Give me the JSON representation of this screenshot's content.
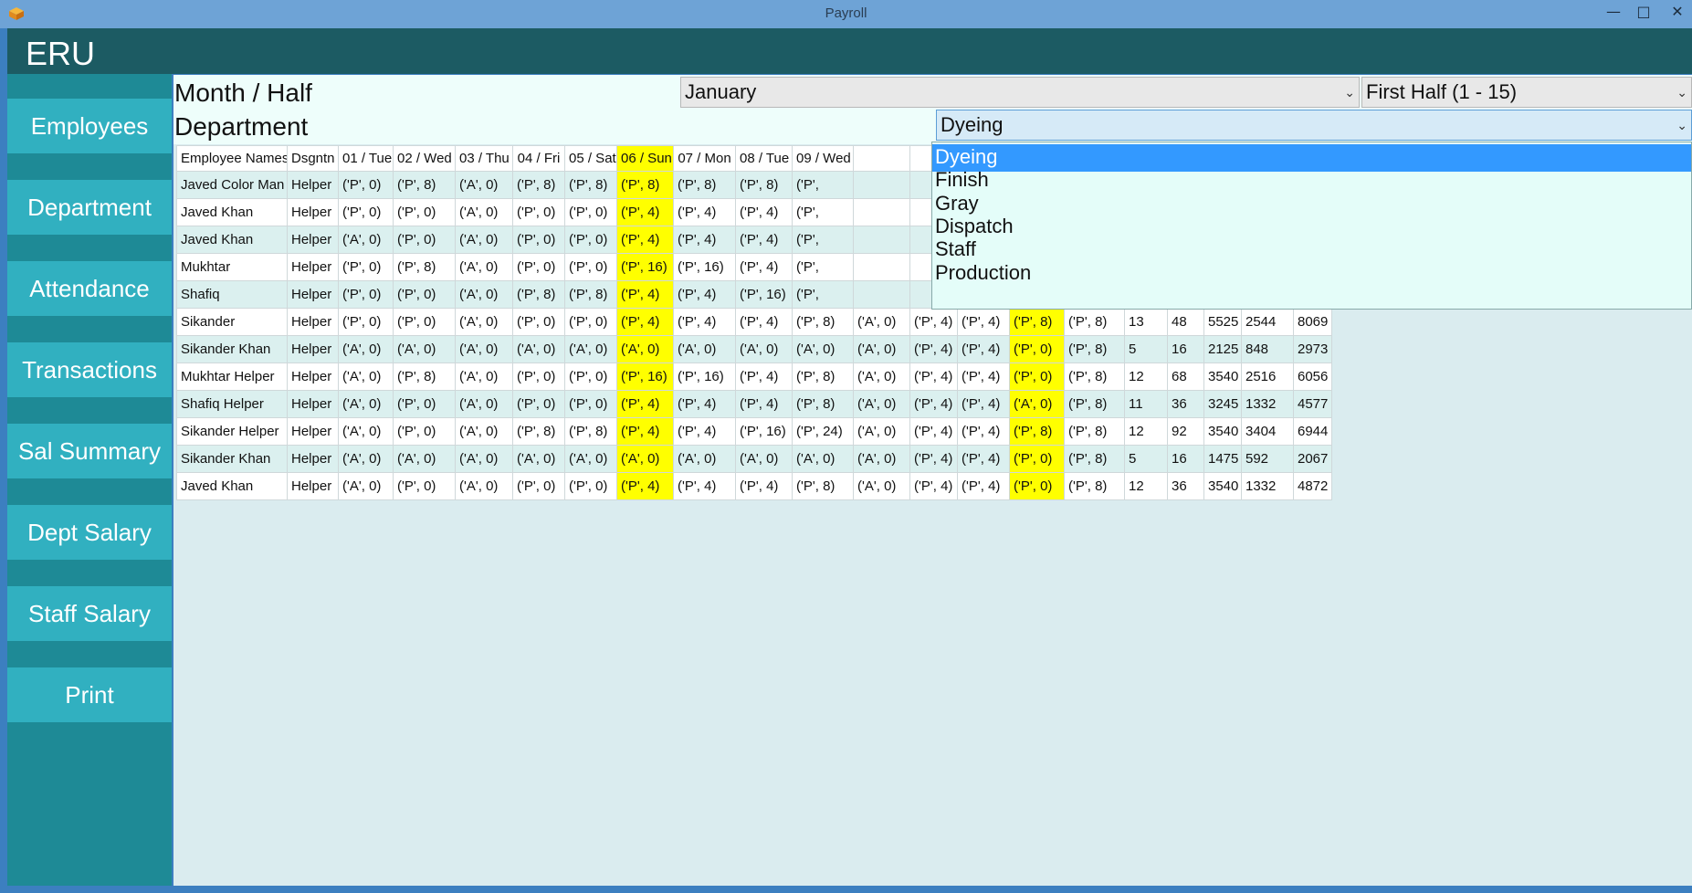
{
  "window": {
    "title": "Payroll",
    "min": "—",
    "max": "□",
    "close": "✕"
  },
  "app": {
    "name": "ERU"
  },
  "sidebar": {
    "items": [
      {
        "label": "Employees"
      },
      {
        "label": "Department"
      },
      {
        "label": "Attendance"
      },
      {
        "label": "Transactions"
      },
      {
        "label": "Sal Summary"
      },
      {
        "label": "Dept Salary"
      },
      {
        "label": "Staff Salary"
      },
      {
        "label": "Print"
      }
    ]
  },
  "filters": {
    "month_label": "Month / Half",
    "department_label": "Department",
    "month_value": "January",
    "half_value": "First Half (1 - 15)",
    "department_value": "Dyeing"
  },
  "dropdown": {
    "options": [
      "Dyeing",
      "Finish",
      "Gray",
      "Dispatch",
      "Staff",
      "Production"
    ],
    "selected": "Dyeing"
  },
  "colors": {
    "highlight": "#ffff00",
    "accent": "#31b0c0",
    "header": "#1c5b63",
    "selection": "#3399ff"
  },
  "table": {
    "headers": [
      "Employee Names",
      "Dsgntn",
      "01 / Tue",
      "02 / Wed",
      "03 / Thu",
      "04 / Fri",
      "05 / Sat",
      "06 / Sun",
      "07 / Mon",
      "08 / Tue",
      "09 / Wed",
      "",
      "",
      "",
      "",
      "",
      "",
      "",
      "",
      "",
      ""
    ],
    "rows": [
      [
        "Javed Color Man",
        "Helper",
        "('P', 0)",
        "('P', 8)",
        "('A', 0)",
        "('P', 8)",
        "('P', 8)",
        "('P', 8)",
        "('P', 8)",
        "('P', 8)",
        "('P', ",
        "",
        "",
        "",
        "",
        "",
        "",
        "",
        "",
        "",
        ""
      ],
      [
        "Javed Khan",
        "Helper",
        "('P', 0)",
        "('P', 0)",
        "('A', 0)",
        "('P', 0)",
        "('P', 0)",
        "('P', 4)",
        "('P', 4)",
        "('P', 4)",
        "('P', ",
        "",
        "",
        "",
        "",
        "",
        "",
        "",
        "",
        "",
        ""
      ],
      [
        "Javed Khan",
        "Helper",
        "('A', 0)",
        "('P', 0)",
        "('A', 0)",
        "('P', 0)",
        "('P', 0)",
        "('P', 4)",
        "('P', 4)",
        "('P', 4)",
        "('P', ",
        "",
        "",
        "",
        "",
        "",
        "",
        "",
        "",
        "",
        ""
      ],
      [
        "Mukhtar",
        "Helper",
        "('P', 0)",
        "('P', 8)",
        "('A', 0)",
        "('P', 0)",
        "('P', 0)",
        "('P', 16)",
        "('P', 16)",
        "('P', 4)",
        "('P', ",
        "",
        "",
        "",
        "",
        "",
        "",
        "",
        "",
        "",
        ""
      ],
      [
        "Shafiq",
        "Helper",
        "('P', 0)",
        "('P', 0)",
        "('A', 0)",
        "('P', 8)",
        "('P', 8)",
        "('P', 4)",
        "('P', 4)",
        "('P', 16)",
        "('P', ",
        "",
        "",
        "",
        "",
        "",
        "",
        "",
        "",
        "",
        ""
      ],
      [
        "Sikander",
        "Helper",
        "('P', 0)",
        "('P', 0)",
        "('A', 0)",
        "('P', 0)",
        "('P', 0)",
        "('P', 4)",
        "('P', 4)",
        "('P', 4)",
        "('P', 8)",
        "('A', 0)",
        "('P', 4)",
        "('P', 4)",
        "('P', 8)",
        "('P', 8)",
        "13",
        "48",
        "5525",
        "2544",
        "8069"
      ],
      [
        "Sikander Khan",
        "Helper",
        "('A', 0)",
        "('A', 0)",
        "('A', 0)",
        "('A', 0)",
        "('A', 0)",
        "('A', 0)",
        "('A', 0)",
        "('A', 0)",
        "('A', 0)",
        "('A', 0)",
        "('P', 4)",
        "('P', 4)",
        "('P', 0)",
        "('P', 8)",
        "5",
        "16",
        "2125",
        "848",
        "2973"
      ],
      [
        "Mukhtar Helper",
        "Helper",
        "('A', 0)",
        "('P', 8)",
        "('A', 0)",
        "('P', 0)",
        "('P', 0)",
        "('P', 16)",
        "('P', 16)",
        "('P', 4)",
        "('P', 8)",
        "('A', 0)",
        "('P', 4)",
        "('P', 4)",
        "('P', 0)",
        "('P', 8)",
        "12",
        "68",
        "3540",
        "2516",
        "6056"
      ],
      [
        "Shafiq Helper",
        "Helper",
        "('A', 0)",
        "('P', 0)",
        "('A', 0)",
        "('P', 0)",
        "('P', 0)",
        "('P', 4)",
        "('P', 4)",
        "('P', 4)",
        "('P', 8)",
        "('A', 0)",
        "('P', 4)",
        "('P', 4)",
        "('A', 0)",
        "('P', 8)",
        "11",
        "36",
        "3245",
        "1332",
        "4577"
      ],
      [
        "Sikander Helper",
        "Helper",
        "('A', 0)",
        "('P', 0)",
        "('A', 0)",
        "('P', 8)",
        "('P', 8)",
        "('P', 4)",
        "('P', 4)",
        "('P', 16)",
        "('P', 24)",
        "('A', 0)",
        "('P', 4)",
        "('P', 4)",
        "('P', 8)",
        "('P', 8)",
        "12",
        "92",
        "3540",
        "3404",
        "6944"
      ],
      [
        "Sikander Khan",
        "Helper",
        "('A', 0)",
        "('A', 0)",
        "('A', 0)",
        "('A', 0)",
        "('A', 0)",
        "('A', 0)",
        "('A', 0)",
        "('A', 0)",
        "('A', 0)",
        "('A', 0)",
        "('P', 4)",
        "('P', 4)",
        "('P', 0)",
        "('P', 8)",
        "5",
        "16",
        "1475",
        "592",
        "2067"
      ],
      [
        "Javed Khan",
        "Helper",
        "('A', 0)",
        "('P', 0)",
        "('A', 0)",
        "('P', 0)",
        "('P', 0)",
        "('P', 4)",
        "('P', 4)",
        "('P', 4)",
        "('P', 8)",
        "('A', 0)",
        "('P', 4)",
        "('P', 4)",
        "('P', 0)",
        "('P', 8)",
        "12",
        "36",
        "3540",
        "1332",
        "4872"
      ]
    ],
    "highlight_columns": [
      7,
      14
    ]
  }
}
